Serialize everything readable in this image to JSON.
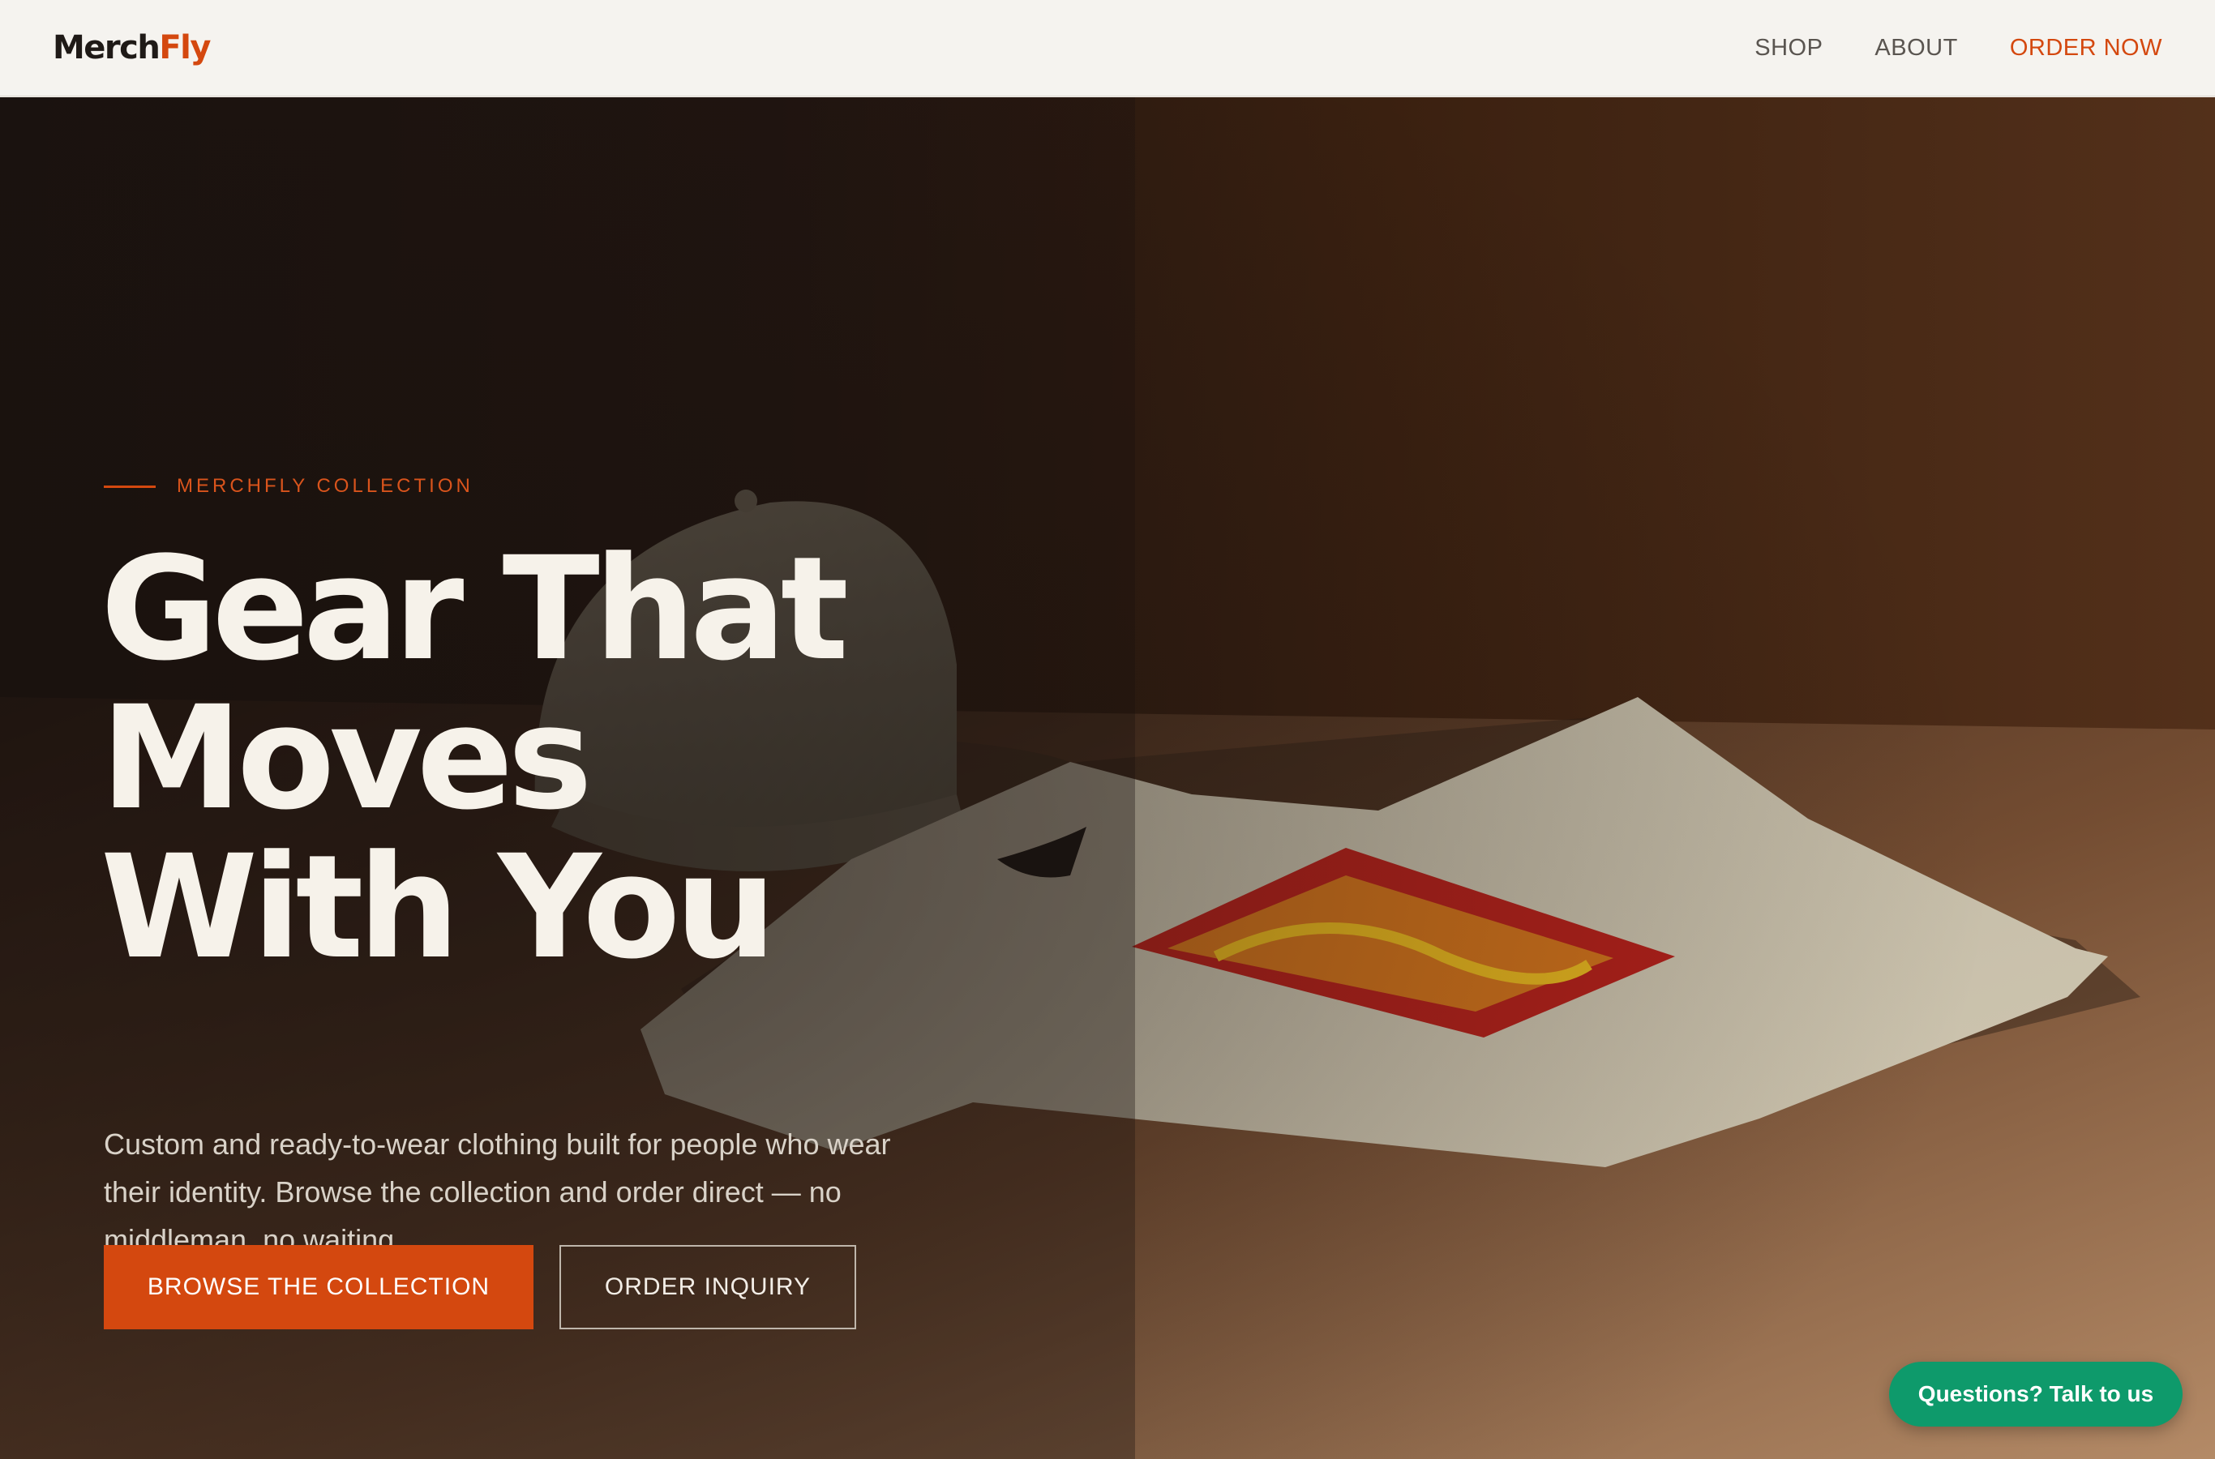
{
  "brand": {
    "name_part1": "Merch",
    "name_part2": "Fly",
    "accent_color": "#d4480f"
  },
  "nav": {
    "items": [
      {
        "label": "SHOP"
      },
      {
        "label": "ABOUT"
      },
      {
        "label": "ORDER NOW"
      }
    ]
  },
  "hero": {
    "eyebrow": "MERCHFLY COLLECTION",
    "headline_lines": [
      "Gear That",
      "Moves",
      "With You"
    ],
    "subcopy": "Custom and ready-to-wear clothing built for people who wear their identity. Browse the collection and order direct — no middleman, no waiting.",
    "primary_button": "BROWSE THE COLLECTION",
    "secondary_button": "ORDER INQUIRY",
    "image": {
      "subject": [
        "baseball-cap",
        "graphic-t-shirt"
      ],
      "shirt_print_colors": [
        "#b0201a",
        "#e3b31e"
      ]
    }
  },
  "chat": {
    "label": "Questions? Talk to us",
    "color": "#0e9a6b"
  }
}
